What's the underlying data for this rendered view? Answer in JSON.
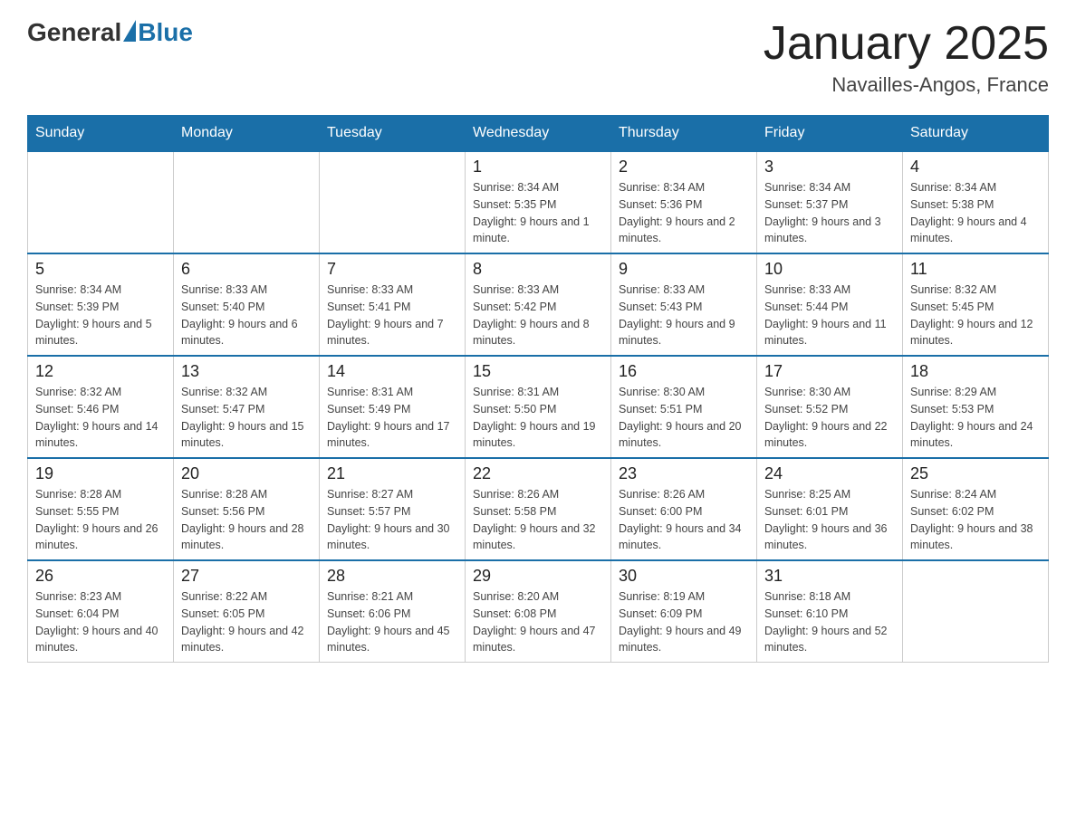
{
  "header": {
    "logo_general": "General",
    "logo_blue": "Blue",
    "title": "January 2025",
    "subtitle": "Navailles-Angos, France"
  },
  "days": [
    "Sunday",
    "Monday",
    "Tuesday",
    "Wednesday",
    "Thursday",
    "Friday",
    "Saturday"
  ],
  "weeks": [
    [
      {
        "day": "",
        "info": ""
      },
      {
        "day": "",
        "info": ""
      },
      {
        "day": "",
        "info": ""
      },
      {
        "day": "1",
        "info": "Sunrise: 8:34 AM\nSunset: 5:35 PM\nDaylight: 9 hours and 1 minute."
      },
      {
        "day": "2",
        "info": "Sunrise: 8:34 AM\nSunset: 5:36 PM\nDaylight: 9 hours and 2 minutes."
      },
      {
        "day": "3",
        "info": "Sunrise: 8:34 AM\nSunset: 5:37 PM\nDaylight: 9 hours and 3 minutes."
      },
      {
        "day": "4",
        "info": "Sunrise: 8:34 AM\nSunset: 5:38 PM\nDaylight: 9 hours and 4 minutes."
      }
    ],
    [
      {
        "day": "5",
        "info": "Sunrise: 8:34 AM\nSunset: 5:39 PM\nDaylight: 9 hours and 5 minutes."
      },
      {
        "day": "6",
        "info": "Sunrise: 8:33 AM\nSunset: 5:40 PM\nDaylight: 9 hours and 6 minutes."
      },
      {
        "day": "7",
        "info": "Sunrise: 8:33 AM\nSunset: 5:41 PM\nDaylight: 9 hours and 7 minutes."
      },
      {
        "day": "8",
        "info": "Sunrise: 8:33 AM\nSunset: 5:42 PM\nDaylight: 9 hours and 8 minutes."
      },
      {
        "day": "9",
        "info": "Sunrise: 8:33 AM\nSunset: 5:43 PM\nDaylight: 9 hours and 9 minutes."
      },
      {
        "day": "10",
        "info": "Sunrise: 8:33 AM\nSunset: 5:44 PM\nDaylight: 9 hours and 11 minutes."
      },
      {
        "day": "11",
        "info": "Sunrise: 8:32 AM\nSunset: 5:45 PM\nDaylight: 9 hours and 12 minutes."
      }
    ],
    [
      {
        "day": "12",
        "info": "Sunrise: 8:32 AM\nSunset: 5:46 PM\nDaylight: 9 hours and 14 minutes."
      },
      {
        "day": "13",
        "info": "Sunrise: 8:32 AM\nSunset: 5:47 PM\nDaylight: 9 hours and 15 minutes."
      },
      {
        "day": "14",
        "info": "Sunrise: 8:31 AM\nSunset: 5:49 PM\nDaylight: 9 hours and 17 minutes."
      },
      {
        "day": "15",
        "info": "Sunrise: 8:31 AM\nSunset: 5:50 PM\nDaylight: 9 hours and 19 minutes."
      },
      {
        "day": "16",
        "info": "Sunrise: 8:30 AM\nSunset: 5:51 PM\nDaylight: 9 hours and 20 minutes."
      },
      {
        "day": "17",
        "info": "Sunrise: 8:30 AM\nSunset: 5:52 PM\nDaylight: 9 hours and 22 minutes."
      },
      {
        "day": "18",
        "info": "Sunrise: 8:29 AM\nSunset: 5:53 PM\nDaylight: 9 hours and 24 minutes."
      }
    ],
    [
      {
        "day": "19",
        "info": "Sunrise: 8:28 AM\nSunset: 5:55 PM\nDaylight: 9 hours and 26 minutes."
      },
      {
        "day": "20",
        "info": "Sunrise: 8:28 AM\nSunset: 5:56 PM\nDaylight: 9 hours and 28 minutes."
      },
      {
        "day": "21",
        "info": "Sunrise: 8:27 AM\nSunset: 5:57 PM\nDaylight: 9 hours and 30 minutes."
      },
      {
        "day": "22",
        "info": "Sunrise: 8:26 AM\nSunset: 5:58 PM\nDaylight: 9 hours and 32 minutes."
      },
      {
        "day": "23",
        "info": "Sunrise: 8:26 AM\nSunset: 6:00 PM\nDaylight: 9 hours and 34 minutes."
      },
      {
        "day": "24",
        "info": "Sunrise: 8:25 AM\nSunset: 6:01 PM\nDaylight: 9 hours and 36 minutes."
      },
      {
        "day": "25",
        "info": "Sunrise: 8:24 AM\nSunset: 6:02 PM\nDaylight: 9 hours and 38 minutes."
      }
    ],
    [
      {
        "day": "26",
        "info": "Sunrise: 8:23 AM\nSunset: 6:04 PM\nDaylight: 9 hours and 40 minutes."
      },
      {
        "day": "27",
        "info": "Sunrise: 8:22 AM\nSunset: 6:05 PM\nDaylight: 9 hours and 42 minutes."
      },
      {
        "day": "28",
        "info": "Sunrise: 8:21 AM\nSunset: 6:06 PM\nDaylight: 9 hours and 45 minutes."
      },
      {
        "day": "29",
        "info": "Sunrise: 8:20 AM\nSunset: 6:08 PM\nDaylight: 9 hours and 47 minutes."
      },
      {
        "day": "30",
        "info": "Sunrise: 8:19 AM\nSunset: 6:09 PM\nDaylight: 9 hours and 49 minutes."
      },
      {
        "day": "31",
        "info": "Sunrise: 8:18 AM\nSunset: 6:10 PM\nDaylight: 9 hours and 52 minutes."
      },
      {
        "day": "",
        "info": ""
      }
    ]
  ]
}
